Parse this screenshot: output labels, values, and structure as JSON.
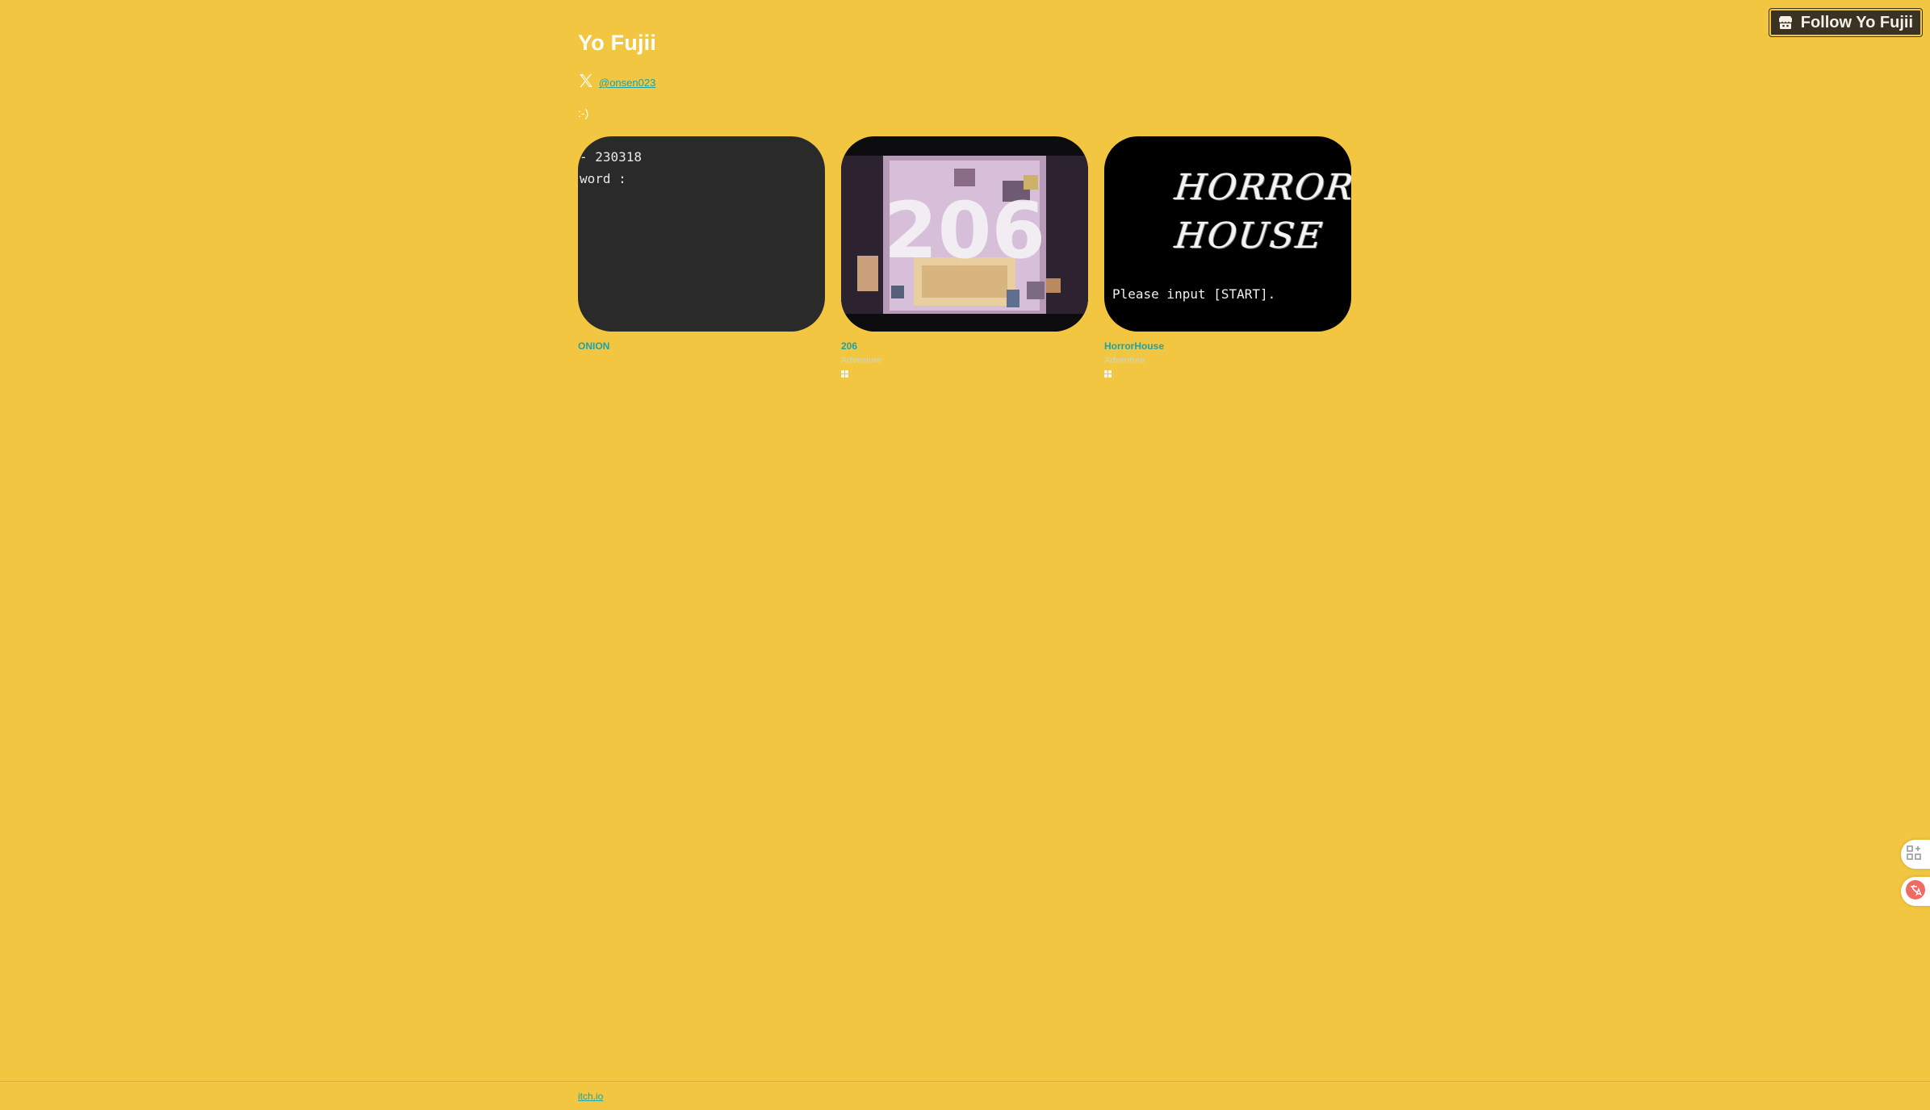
{
  "header": {
    "title": "Yo Fujii",
    "social_handle": "@onsen023",
    "social_icon": "x-logo-icon",
    "bio": ":-)"
  },
  "follow_button": {
    "label": "Follow Yo Fujii",
    "icon": "itch-logo-icon"
  },
  "games": [
    {
      "title": "ONION",
      "thumbnail_lines": [
        "- 230318",
        "word :"
      ],
      "genre": "",
      "platform_icon": ""
    },
    {
      "title": "206",
      "genre": "Adventure",
      "platform_icon": "windows-icon",
      "thumbnail_caption": "206"
    },
    {
      "title": "HorrorHouse",
      "genre": "Adventure",
      "platform_icon": "windows-icon",
      "thumbnail_lines": [
        "HORROR",
        "HOUSE"
      ],
      "thumbnail_prompt": "Please input [START]."
    }
  ],
  "footer": {
    "link_label": "itch.io"
  },
  "side_buttons": [
    "add-widget-icon",
    "translate-icon"
  ],
  "colors": {
    "background": "#f2c641",
    "link": "#1ba3a8",
    "title": "#ffffff"
  }
}
